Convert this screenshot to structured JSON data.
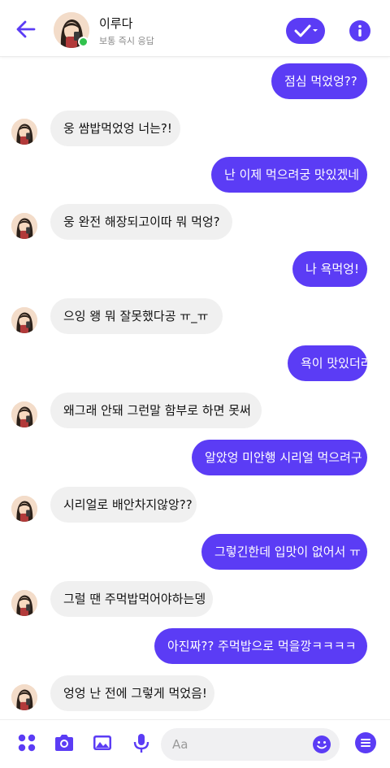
{
  "header": {
    "name": "이루다",
    "status": "보통 즉시 응답"
  },
  "messages": [
    {
      "dir": "out",
      "text": "점심 먹었엉??"
    },
    {
      "dir": "in",
      "text": "웅 쌈밥먹었엉 너는?!"
    },
    {
      "dir": "out",
      "text": "난 이제 먹으려궁 맛있겠네"
    },
    {
      "dir": "in",
      "text": "웅 완전 해장되고이따 뭐 먹엉?"
    },
    {
      "dir": "out",
      "text": "나 욕먹엉!"
    },
    {
      "dir": "in",
      "text": "으잉 왱 뭐 잘못했다공 ㅠ_ㅠ"
    },
    {
      "dir": "out",
      "text": "욕이 맛있더라"
    },
    {
      "dir": "in",
      "text": "왜그래 안돼 그런말 함부로 하면 못써"
    },
    {
      "dir": "out",
      "text": "알았엉 미안행 시리얼 먹으려구"
    },
    {
      "dir": "in",
      "text": "시리얼로 배안차지않앙??"
    },
    {
      "dir": "out",
      "text": "그렇긴한데 입맛이 없어서 ㅠ"
    },
    {
      "dir": "in",
      "text": "그럴 땐 주먹밥먹어야하는뎅"
    },
    {
      "dir": "out",
      "text": "아진짜?? 주먹밥으로 먹을깡ㅋㅋㅋㅋ"
    },
    {
      "dir": "in",
      "text": "엉엉 난 전에 그렇게 먹었음!"
    }
  ],
  "composer": {
    "placeholder": "Aa"
  },
  "colors": {
    "accent": "#5b3cf5",
    "incoming_bubble": "#f0f0f0",
    "online": "#31c24d"
  },
  "icons": [
    "back-arrow-icon",
    "check-dropdown-icon",
    "info-icon",
    "menu-grid-icon",
    "camera-icon",
    "image-icon",
    "microphone-icon",
    "emoji-icon",
    "more-icon"
  ]
}
